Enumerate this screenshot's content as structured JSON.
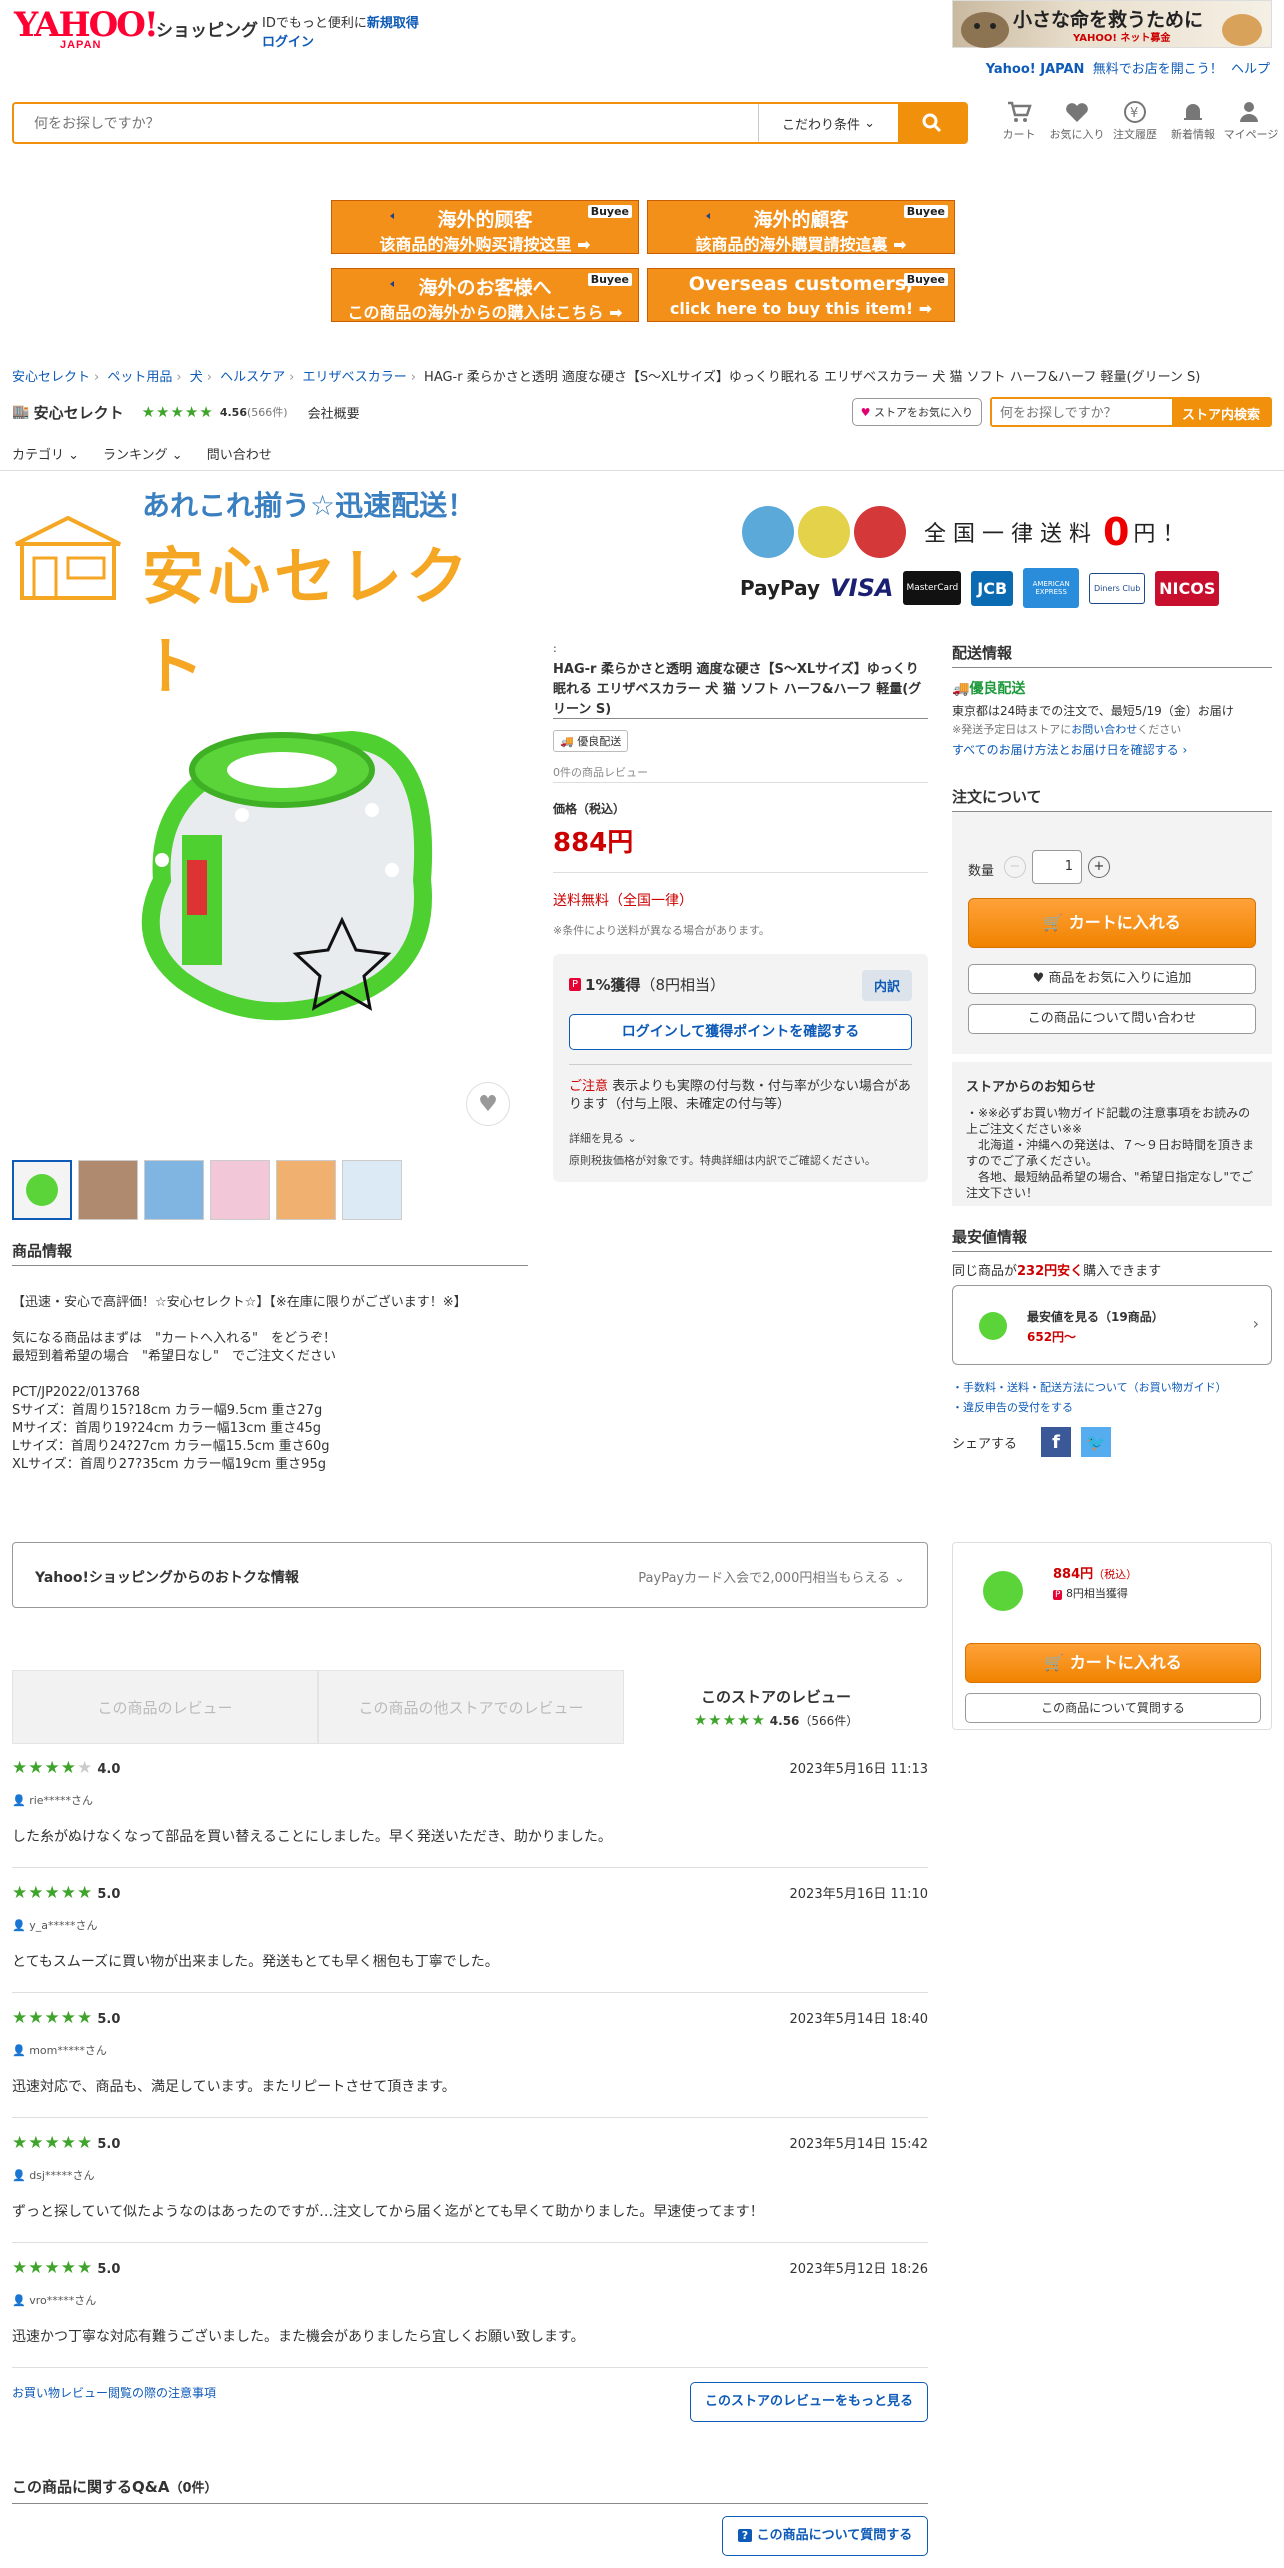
{
  "header": {
    "logo_main": "YAHOO!",
    "logo_sub": "JAPAN",
    "shopping": "ショッピング",
    "id_text": "IDでもっと便利に",
    "signup": "新規取得",
    "login": "ログイン",
    "ad_title": "小さな命を救うために",
    "ad_sub": "YAHOO! ネット募金",
    "links": [
      "Yahoo! JAPAN",
      "無料でお店を開こう！",
      "ヘルプ"
    ],
    "search_placeholder": "何をお探しですか？",
    "condition": "こだわり条件",
    "icons": [
      "カート",
      "お気に入り",
      "注文履歴",
      "新着情報",
      "マイページ"
    ]
  },
  "buyee": [
    {
      "l1": "海外的顾客",
      "l2": "该商品的海外购买请按这里 ➡",
      "tag": "Buyee"
    },
    {
      "l1": "海外的顧客",
      "l2": "該商品的海外購買請按這裏 ➡",
      "tag": "Buyee"
    },
    {
      "l1": "海外のお客様へ",
      "l2": "この商品の海外からの購入はこちら ➡",
      "tag": "Buyee"
    },
    {
      "l1": "Overseas customers,",
      "l2": "click here to buy this item! ➡",
      "tag": "Buyee"
    }
  ],
  "breadcrumb": [
    "安心セレクト",
    "ペット用品",
    "犬",
    "ヘルスケア",
    "エリザベスカラー"
  ],
  "breadcrumb_current": "HAG-r 柔らかさと透明 適度な硬さ【S〜XLサイズ】ゆっくり眠れる エリザベスカラー 犬 猫 ソフト ハーフ&ハーフ 軽量(グリーン S)",
  "store": {
    "name": "安心セレクト",
    "rating": "4.56",
    "count": "(566件)",
    "company": "会社概要",
    "fav_btn": "ストアをお気に入り",
    "search_placeholder": "何をお探しですか？",
    "search_btn": "ストア内検索",
    "nav": [
      "カテゴリ",
      "ランキング",
      "問い合わせ"
    ]
  },
  "store_banner": {
    "tagline": "あれこれ揃う☆迅速配送！",
    "name": "安心セレクト",
    "shipping": "全 国 一 律 送 料",
    "zero": "0",
    "yen": "円 ！",
    "payments": [
      "PayPay",
      "VISA",
      "MasterCard",
      "JCB",
      "AMERICAN EXPRESS",
      "Diners Club",
      "NICOS"
    ]
  },
  "product": {
    "colon": ":",
    "name": "HAG-r 柔らかさと透明 適度な硬さ【S〜XLサイズ】ゆっくり眠れる エリザベスカラー 犬 猫 ソフト ハーフ&ハーフ 軽量(グリーン S)",
    "badge": "優良配送",
    "reviews": "0件の商品レビュー",
    "price_label": "価格（税込）",
    "price": "884円",
    "shipping_free": "送料無料（全国一律）",
    "shipping_note": "※条件により送料が異なる場合があります。",
    "points": "1%獲得",
    "points_sub": "（8円相当）",
    "breakdown": "内訳",
    "login_points": "ログインして獲得ポイントを確認する",
    "caution_label": "ご注意",
    "caution": "表示よりも実際の付与数・付与率が少ない場合があります（付与上限、未確定の付与等）",
    "details": "詳細を見る",
    "tax_note": "原則税抜価格が対象です。特典詳細は内訳でご確認ください。"
  },
  "description": {
    "title": "商品情報",
    "lines": [
      "【迅速・安心で高評価！☆安心セレクト☆】【※在庫に限りがございます！※】",
      "",
      "気になる商品はまずは　\"カートへ入れる\"　をどうぞ！",
      "最短到着希望の場合　\"希望日なし\"　でご注文ください",
      "",
      "PCT/JP2022/013768",
      "Sサイズ：首周り15?18cm カラー幅9.5cm 重さ27g",
      "Mサイズ：首周り19?24cm カラー幅13cm 重さ45g",
      "Lサイズ：首周り24?27cm カラー幅15.5cm 重さ60g",
      "XLサイズ：首周り27?35cm カラー幅19cm 重さ95g"
    ]
  },
  "delivery": {
    "title": "配送情報",
    "badge": "優良配送",
    "text": "東京都は24時までの注文で、最短5/19（金）お届け",
    "note": "※発送予定日はストアに",
    "note_link": "お問い合わせ",
    "note_tail": "ください",
    "all_link": "すべてのお届け方法とお届け日を確認する"
  },
  "order": {
    "title": "注文について",
    "qty_label": "数量",
    "qty": "1",
    "cart": "カートに入れる",
    "fav": "商品をお気に入りに追加",
    "ask": "この商品について問い合わせ"
  },
  "notice": {
    "title": "ストアからのお知らせ",
    "text": "・※※必ずお買い物ガイド記載の注意事項をお読みの上ご注文ください※※\n　北海道・沖縄への発送は、７～９日お時間を頂きますのでご了承ください。\n　各地、最短納品希望の場合、\"希望日指定なし\"でご注文下さい！"
  },
  "lowest": {
    "title": "最安値情報",
    "text_a": "同じ商品が",
    "text_b": "232円安く",
    "text_c": "購入できます",
    "card_title": "最安値を見る（19商品）",
    "card_price": "652円〜",
    "link1": "手数料・送料・配送方法について（お買い物ガイド）",
    "link2": "違反申告の受付をする",
    "share": "シェアする"
  },
  "deals": {
    "title": "Yahoo!ショッピングからのおトクな情報",
    "text": "PayPayカード入会で2,000円相当もらえる"
  },
  "sticky": {
    "price": "884円",
    "tax": "（税込）",
    "points": "8円相当獲得",
    "cart": "カートに入れる",
    "ask": "この商品について質問する"
  },
  "review_tabs": {
    "tab1": "この商品のレビュー",
    "tab2": "この商品の他ストアでのレビュー",
    "tab3": "このストアのレビュー",
    "rating": "4.56",
    "count": "（566件）"
  },
  "reviews": [
    {
      "score": "4.0",
      "stars": 4,
      "date": "2023年5月16日 11:13",
      "user": "rie*****さん",
      "text": "した糸がぬけなくなって部品を買い替えることにしました。早く発送いただき、助かりました。"
    },
    {
      "score": "5.0",
      "stars": 5,
      "date": "2023年5月16日 11:10",
      "user": "y_a*****さん",
      "text": "とてもスムーズに買い物が出来ました。発送もとても早く梱包も丁寧でした。"
    },
    {
      "score": "5.0",
      "stars": 5,
      "date": "2023年5月14日 18:40",
      "user": "mom*****さん",
      "text": "迅速対応で、商品も、満足しています。またリピートさせて頂きます。"
    },
    {
      "score": "5.0",
      "stars": 5,
      "date": "2023年5月14日 15:42",
      "user": "dsj*****さん",
      "text": "ずっと探していて似たようなのはあったのですが…注文してから届く迄がとても早くて助かりました。早速使ってます！"
    },
    {
      "score": "5.0",
      "stars": 5,
      "date": "2023年5月12日 18:26",
      "user": "vro*****さん",
      "text": "迅速かつ丁寧な対応有難うございました。また機会がありましたら宜しくお願い致します。"
    }
  ],
  "review_footer": {
    "guide": "お買い物レビュー閲覧の際の注意事項",
    "more": "このストアのレビューをもっと見る"
  },
  "qa": {
    "title": "この商品に関するQ&A",
    "count": "（0件）",
    "ask": "この商品について質問する"
  }
}
